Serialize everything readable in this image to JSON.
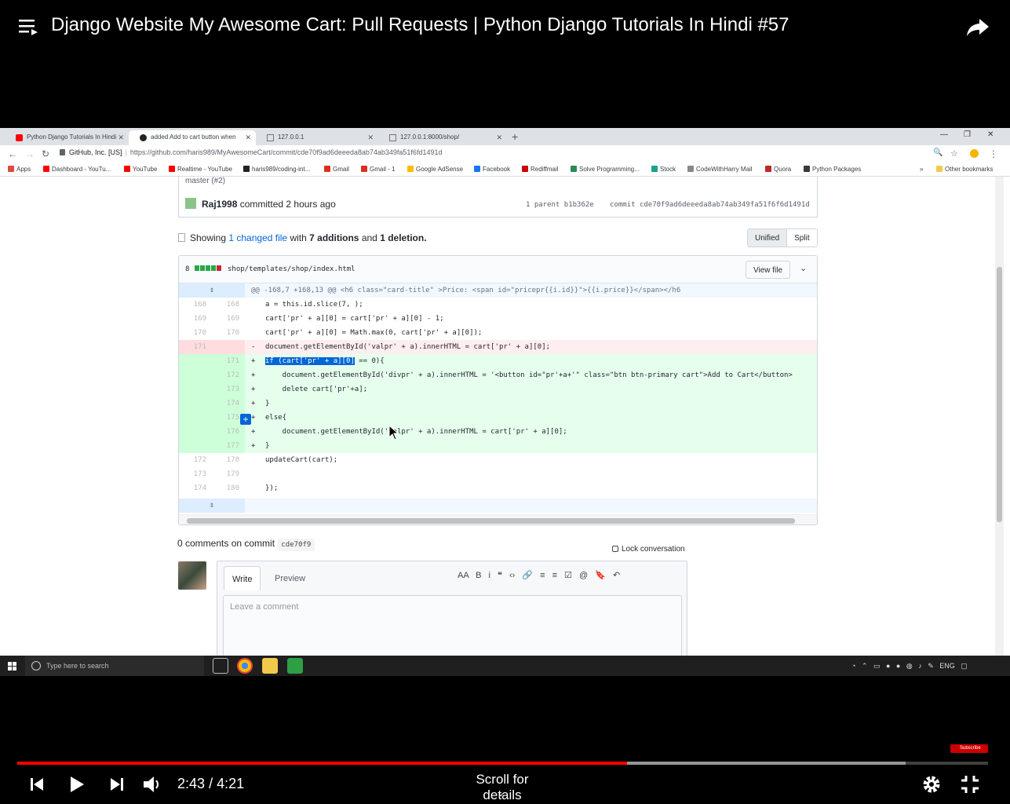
{
  "video": {
    "title": "Django Website My Awesome Cart: Pull Requests | Python Django Tutorials In Hindi #57",
    "time_current": "2:43",
    "time_separator": "/",
    "time_total": "4:21",
    "played_fraction": 0.628,
    "buffered_fraction": 0.915,
    "scroll_hint": "Scroll for details",
    "subscribe_label": "Subscribe"
  },
  "browser": {
    "tabs": [
      {
        "label": "Python Django Tutorials In Hindi",
        "icon": "youtube-icon",
        "active": false
      },
      {
        "label": "added Add to cart button when",
        "icon": "github-icon",
        "active": true
      },
      {
        "label": "127.0.0.1",
        "icon": "page-icon",
        "active": false
      },
      {
        "label": "127.0.0.1:8000/shop/",
        "icon": "page-icon",
        "active": false
      }
    ],
    "address": {
      "site": "GitHub, Inc. [US]",
      "url": "https://github.com/haris989/MyAwesomeCart/commit/cde70f9ad6deeeda8ab74ab349fa51f6fd1491d"
    },
    "bookmarks": [
      {
        "label": "Apps",
        "color": "#e04a3a"
      },
      {
        "label": "Dashboard - YouTu...",
        "color": "#ff0000"
      },
      {
        "label": "YouTube",
        "color": "#ff0000"
      },
      {
        "label": "Realtime - YouTube",
        "color": "#ff0000"
      },
      {
        "label": "haris989/coding-int...",
        "color": "#222222"
      },
      {
        "label": "Gmail",
        "color": "#d93025"
      },
      {
        "label": "Gmail - 1",
        "color": "#d93025"
      },
      {
        "label": "Google AdSense",
        "color": "#fbbc04"
      },
      {
        "label": "Facebook",
        "color": "#1877f2"
      },
      {
        "label": "Rediffmail",
        "color": "#cc0000"
      },
      {
        "label": "Solve Programming...",
        "color": "#2e8b57"
      },
      {
        "label": "Stock",
        "color": "#1aa38a"
      },
      {
        "label": "CodeWithHarry Mail",
        "color": "#888888"
      },
      {
        "label": "Quora",
        "color": "#b92b27"
      },
      {
        "label": "Python Packages",
        "color": "#3a3a3a"
      },
      {
        "label": "Other bookmarks",
        "color": "#f2c94c"
      }
    ]
  },
  "commit": {
    "branch": "master (#2)",
    "author": "Raj1998",
    "committed_text": "committed 2 hours ago",
    "parent_label": "1 parent",
    "parent_sha": "b1b362e",
    "commit_label": "commit",
    "commit_sha": "cde70f9ad6deeeda8ab74ab349fa51f6f6d1491d"
  },
  "summary": {
    "showing": "Showing",
    "changed": "1 changed file",
    "with": "with",
    "additions": "7 additions",
    "and": "and",
    "deletions": "1 deletion."
  },
  "view_toggle": {
    "unified": "Unified",
    "split": "Split"
  },
  "diff": {
    "count": "8",
    "path": "shop/templates/shop/index.html",
    "view_file": "View file",
    "hunk": "@@ -168,7 +168,13 @@ <h6 class=\"card-title\" >Price: <span id=\"pricepr{{i.id}}\">{{i.price}}</span></h6",
    "lines": [
      {
        "type": "ctx",
        "old": "168",
        "new": "168",
        "mark": "",
        "code": "a = this.id.slice(7, );"
      },
      {
        "type": "ctx",
        "old": "169",
        "new": "169",
        "mark": "",
        "code": "cart['pr' + a][0] = cart['pr' + a][0] - 1;"
      },
      {
        "type": "ctx",
        "old": "170",
        "new": "170",
        "mark": "",
        "code": "cart['pr' + a][0] = Math.max(0, cart['pr' + a][0]);"
      },
      {
        "type": "del",
        "old": "171",
        "new": "",
        "mark": "-",
        "code": "document.getElementById('valpr' + a).innerHTML = cart['pr' + a][0];"
      },
      {
        "type": "add",
        "old": "",
        "new": "171",
        "mark": "+",
        "code": "if (cart['pr' + a][0] == 0){"
      },
      {
        "type": "add",
        "old": "",
        "new": "172",
        "mark": "+",
        "code": "    document.getElementById('divpr' + a).innerHTML = '<button id=\"pr'+a+'\" class=\"btn btn-primary cart\">Add to Cart</button>"
      },
      {
        "type": "add",
        "old": "",
        "new": "173",
        "mark": "+",
        "code": "    delete cart['pr'+a];"
      },
      {
        "type": "add",
        "old": "",
        "new": "174",
        "mark": "+",
        "code": "}"
      },
      {
        "type": "add",
        "old": "",
        "new": "175",
        "mark": "+",
        "code": "else{"
      },
      {
        "type": "add",
        "old": "",
        "new": "176",
        "mark": "+",
        "code": "    document.getElementById('valpr' + a).innerHTML = cart['pr' + a][0];"
      },
      {
        "type": "add",
        "old": "",
        "new": "177",
        "mark": "+",
        "code": "}"
      },
      {
        "type": "ctx",
        "old": "172",
        "new": "178",
        "mark": "",
        "code": "updateCart(cart);"
      },
      {
        "type": "ctx",
        "old": "173",
        "new": "179",
        "mark": "",
        "code": ""
      },
      {
        "type": "ctx",
        "old": "174",
        "new": "180",
        "mark": "",
        "code": "});"
      }
    ]
  },
  "comments": {
    "title": "0 comments on commit",
    "sha": "cde70f9",
    "lock": "Lock conversation",
    "tab_write": "Write",
    "tab_preview": "Preview",
    "placeholder": "Leave a comment",
    "tools": "AA B i ❝ ‹› 🔗 ≡ ≡ ☑ @ 🔖 ↶"
  },
  "taskbar": {
    "search_placeholder": "Type here to search",
    "tray": "ENG"
  }
}
